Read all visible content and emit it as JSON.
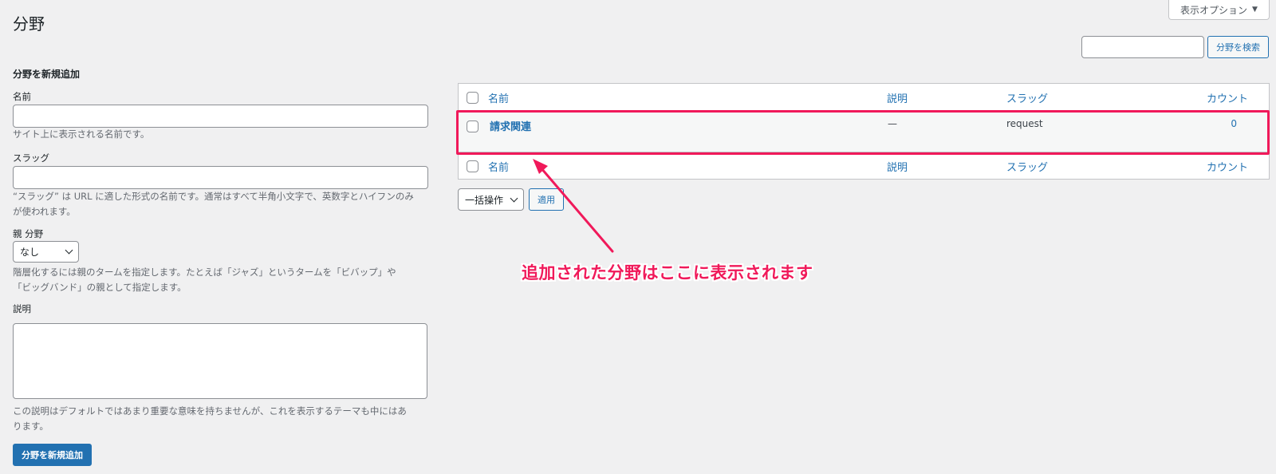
{
  "page": {
    "title": "分野"
  },
  "screen_options": {
    "label": "表示オプション",
    "arrow": "▼"
  },
  "search": {
    "value": "",
    "button_label": "分野を検索"
  },
  "add_form": {
    "heading": "分野を新規追加",
    "name": {
      "label": "名前",
      "value": "",
      "help": "サイト上に表示される名前です。"
    },
    "slug": {
      "label": "スラッグ",
      "value": "",
      "help_line1": "“スラッグ” は URL に適した形式の名前です。通常はすべて半角小文字で、英数字とハイフンのみ",
      "help_line2": "が使われます。"
    },
    "parent": {
      "label": "親 分野",
      "selected": "なし",
      "help_line1": "階層化するには親のタームを指定します。たとえば「ジャズ」というタームを「ビバップ」や",
      "help_line2": "「ビッグバンド」の親として指定します。"
    },
    "description": {
      "label": "説明",
      "value": "",
      "help_line1": "この説明はデフォルトではあまり重要な意味を持ちませんが、これを表示するテーマも中にはあ",
      "help_line2": "ります。"
    },
    "submit_label": "分野を新規追加"
  },
  "table": {
    "columns": {
      "name": "名前",
      "description": "説明",
      "slug": "スラッグ",
      "count": "カウント"
    },
    "rows": [
      {
        "name": "請求関連",
        "description": "—",
        "slug": "request",
        "count": "0"
      }
    ]
  },
  "bulk": {
    "selected": "一括操作",
    "apply_label": "適用"
  },
  "annotation": {
    "text": "追加された分野はここに表示されます",
    "color": "#f0195a"
  },
  "colors": {
    "accent": "#2271b1",
    "background": "#f0f0f1",
    "highlight": "#f0195a"
  }
}
